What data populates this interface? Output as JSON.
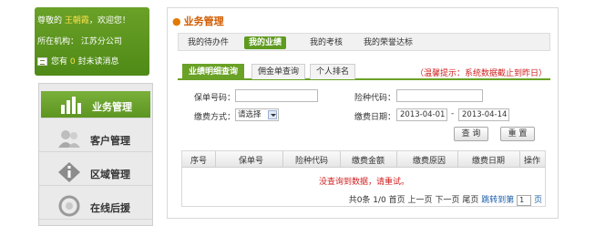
{
  "user": {
    "greeting_prefix": "尊敬的",
    "name": "王朝霞",
    "greeting_suffix": "，欢迎您！",
    "org_label": "所在机构：",
    "org_name": "江苏分公司",
    "msg_prefix": "您有",
    "msg_count": "0",
    "msg_suffix": "封未读消息"
  },
  "menu": {
    "items": [
      {
        "label": "业务管理",
        "icon": "bar-chart-icon",
        "active": true
      },
      {
        "label": "客户管理",
        "icon": "people-icon",
        "active": false
      },
      {
        "label": "区域管理",
        "icon": "info-icon",
        "active": false
      },
      {
        "label": "在线后援",
        "icon": "support-icon",
        "active": false
      }
    ]
  },
  "panel": {
    "title": "业务管理",
    "tabs": [
      {
        "label": "我的待办件",
        "active": false
      },
      {
        "label": "我的业绩",
        "active": true
      },
      {
        "label": "我的考核",
        "active": false
      },
      {
        "label": "我的荣誉达标",
        "active": false
      }
    ],
    "subtabs": [
      {
        "label": "业绩明细查询",
        "active": true
      },
      {
        "label": "佣金单查询",
        "active": false
      },
      {
        "label": "个人排名",
        "active": false
      }
    ],
    "notice": "（温馨提示：系统数据截止到昨日）"
  },
  "form": {
    "policy_no_label": "保单号码：",
    "policy_no_value": "",
    "risk_code_label": "险种代码：",
    "risk_code_value": "",
    "pay_method_label": "缴费方式：",
    "pay_method_value": "请选择",
    "pay_date_label": "缴费日期：",
    "date_from": "2013-04-01",
    "date_sep": "-",
    "date_to": "2013-04-14",
    "query_button": "查 询",
    "reset_button": "重 置"
  },
  "table": {
    "columns": [
      "序号",
      "保单号",
      "险种代码",
      "缴费金额",
      "缴费原因",
      "缴费日期",
      "操作"
    ],
    "empty_message": "没查询到数据，请重试。"
  },
  "pager": {
    "total": "共0条",
    "page": "1/0",
    "first": "首页",
    "prev": "上一页",
    "next": "下一页",
    "last": "尾页",
    "jump_label": "跳转到第",
    "page_input": "1",
    "page_suffix": "页"
  },
  "colors": {
    "brand_green": "#5f9b1f",
    "title_orange": "#d05b00",
    "alert_red": "#d01e1e"
  }
}
